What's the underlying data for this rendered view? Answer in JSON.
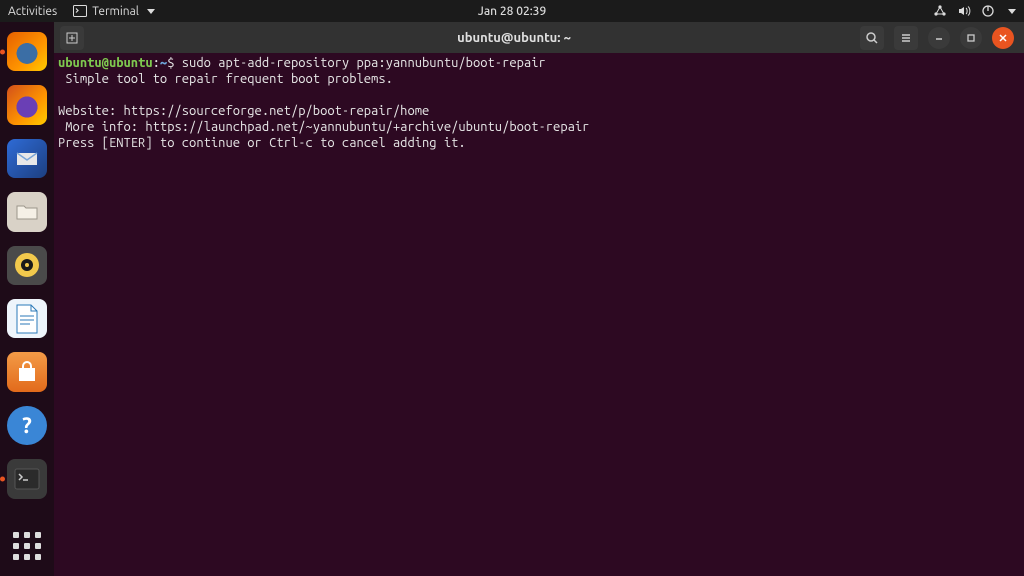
{
  "topbar": {
    "activities": "Activities",
    "app_label": "Terminal",
    "clock": "Jan 28  02:39"
  },
  "tooltip": "LibreOffice Writer",
  "window": {
    "title": "ubuntu@ubuntu: ~"
  },
  "terminal": {
    "prompt_user_host": "ubuntu@ubuntu",
    "prompt_sep1": ":",
    "prompt_path": "~",
    "prompt_sep2": "$ ",
    "command": "sudo apt-add-repository ppa:yannubuntu/boot-repair",
    "line1": " Simple tool to repair frequent boot problems.",
    "line2": "",
    "line3": "Website: https://sourceforge.net/p/boot-repair/home",
    "line4": " More info: https://launchpad.net/~yannubuntu/+archive/ubuntu/boot-repair",
    "line5": "Press [ENTER] to continue or Ctrl-c to cancel adding it."
  }
}
